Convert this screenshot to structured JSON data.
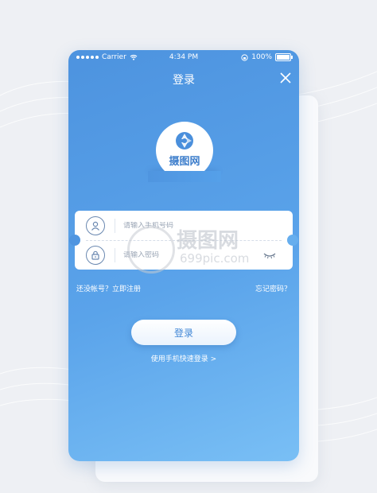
{
  "status_bar": {
    "carrier": "Carrier",
    "time": "4:34 PM",
    "battery": "100%"
  },
  "header": {
    "title": "登录"
  },
  "logo": {
    "text": "摄图网"
  },
  "form": {
    "phone_placeholder": "请输入手机号码",
    "password_placeholder": "请输入密码"
  },
  "links": {
    "register": "还没帐号？立即注册",
    "forgot": "忘记密码？"
  },
  "actions": {
    "login_label": "登录",
    "phone_login_label": "使用手机快速登录 >"
  },
  "watermark": {
    "name": "摄图网",
    "url": "699pic.com"
  },
  "colors": {
    "primary": "#4d93df",
    "primary_light": "#79bff5",
    "button_text": "#3f86d6"
  }
}
